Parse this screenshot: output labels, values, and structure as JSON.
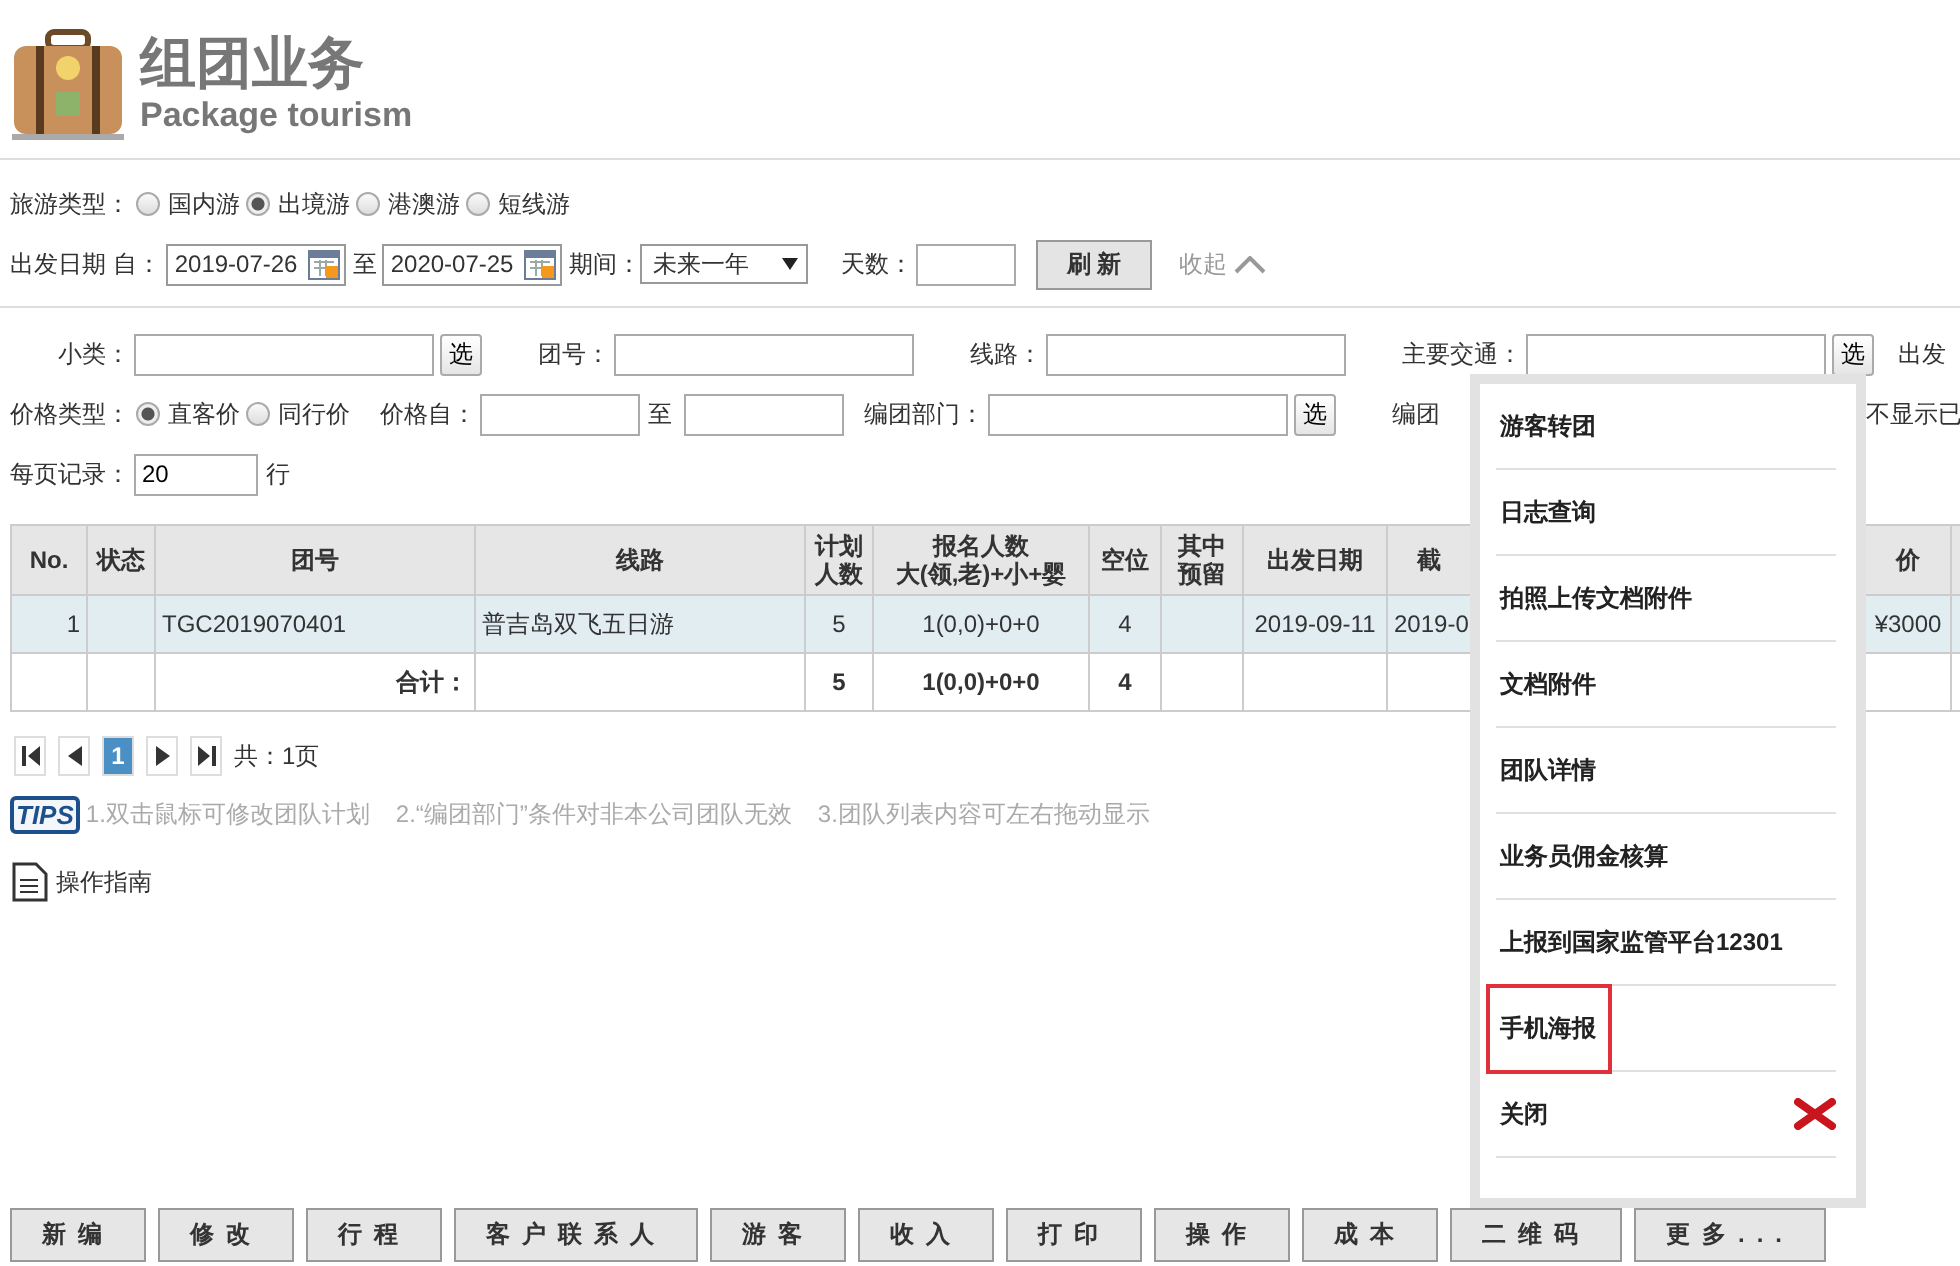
{
  "header": {
    "title": "组团业务",
    "subtitle": "Package tourism"
  },
  "tour_type": {
    "label": "旅游类型：",
    "options": [
      {
        "label": "国内游",
        "selected": false
      },
      {
        "label": "出境游",
        "selected": true
      },
      {
        "label": "港澳游",
        "selected": false
      },
      {
        "label": "短线游",
        "selected": false
      }
    ]
  },
  "date_row": {
    "label": "出发日期 自：",
    "from": "2019-07-26",
    "to_label": "至",
    "to": "2020-07-25",
    "period_label": "期间：",
    "period": "未来一年",
    "days_label": "天数：",
    "refresh": "刷 新",
    "collapse": "收起"
  },
  "filters": [
    [
      {
        "kind": "field",
        "label": "小类：",
        "pick": "选"
      },
      {
        "kind": "field",
        "label": "团号："
      },
      {
        "kind": "field",
        "label": "线路："
      },
      {
        "kind": "field",
        "label": "主要交通：",
        "pick": "选"
      },
      {
        "kind": "text",
        "label": "出发"
      }
    ],
    [
      {
        "kind": "radios",
        "label": "价格类型：",
        "options": [
          {
            "label": "直客价",
            "selected": true
          },
          {
            "label": "同行价",
            "selected": false
          }
        ]
      },
      {
        "kind": "range",
        "label": "价格自：",
        "sep": "至"
      },
      {
        "kind": "field",
        "label": "编团部门：",
        "pick": "选"
      },
      {
        "kind": "text",
        "label": "编团"
      },
      {
        "kind": "far",
        "label": "不显示已"
      }
    ],
    [
      {
        "kind": "short",
        "label": "每页记录：",
        "value": "20",
        "suffix": "行"
      }
    ]
  ],
  "table": {
    "columns": [
      {
        "lines": [
          "No."
        ]
      },
      {
        "lines": [
          "状态"
        ]
      },
      {
        "lines": [
          "团号"
        ]
      },
      {
        "lines": [
          "线路"
        ]
      },
      {
        "lines": [
          "计划",
          "人数"
        ]
      },
      {
        "lines": [
          "报名人数",
          "大(领,老)+小+婴"
        ]
      },
      {
        "lines": [
          "空位"
        ]
      },
      {
        "lines": [
          "其中",
          "预留"
        ]
      },
      {
        "lines": [
          "出发日期"
        ]
      },
      {
        "lines": [
          "截"
        ]
      },
      {},
      {
        "lines": [
          "价"
        ]
      },
      {}
    ],
    "rows": [
      {
        "kind": "data",
        "selected": true,
        "cells": [
          "1",
          null,
          "TGC2019070401",
          "普吉岛双飞五日游",
          "5",
          "1(0,0)+0+0",
          "4",
          null,
          "2019-09-11",
          "2019-0",
          null,
          "¥3000",
          null
        ]
      },
      {
        "kind": "total",
        "selected": false,
        "cells": [
          null,
          null,
          "合计：",
          null,
          "5",
          "1(0,0)+0+0",
          "4",
          null,
          null,
          null,
          null,
          null,
          null
        ]
      }
    ]
  },
  "pager": {
    "pages": [
      {
        "label": "1",
        "selected": true
      }
    ],
    "total": "共：1页"
  },
  "tips": {
    "badge": "TIPS",
    "items": [
      "1.双击鼠标可修改团队计划",
      "2.“编团部门”条件对非本公司团队无效",
      "3.团队列表内容可左右拖动显示"
    ]
  },
  "guide": "操作指南",
  "buttons": [
    "新编",
    "修改",
    "行程",
    "客户联系人",
    "游客",
    "收入",
    "打印",
    "操作",
    "成本",
    "二维码",
    "更多..."
  ],
  "menu": {
    "items": [
      {
        "kind": "action",
        "label": "游客转团",
        "selected": false
      },
      {
        "kind": "action",
        "label": "日志查询",
        "selected": false
      },
      {
        "kind": "action",
        "label": "拍照上传文档附件",
        "selected": false
      },
      {
        "kind": "action",
        "label": "文档附件",
        "selected": false
      },
      {
        "kind": "action",
        "label": "团队详情",
        "selected": false
      },
      {
        "kind": "action",
        "label": "业务员佣金核算",
        "selected": false
      },
      {
        "kind": "action",
        "label": "上报到国家监管平台12301",
        "selected": false
      },
      {
        "kind": "action",
        "label": "手机海报",
        "selected": true
      },
      {
        "kind": "close",
        "label": "关闭",
        "selected": false
      }
    ]
  }
}
